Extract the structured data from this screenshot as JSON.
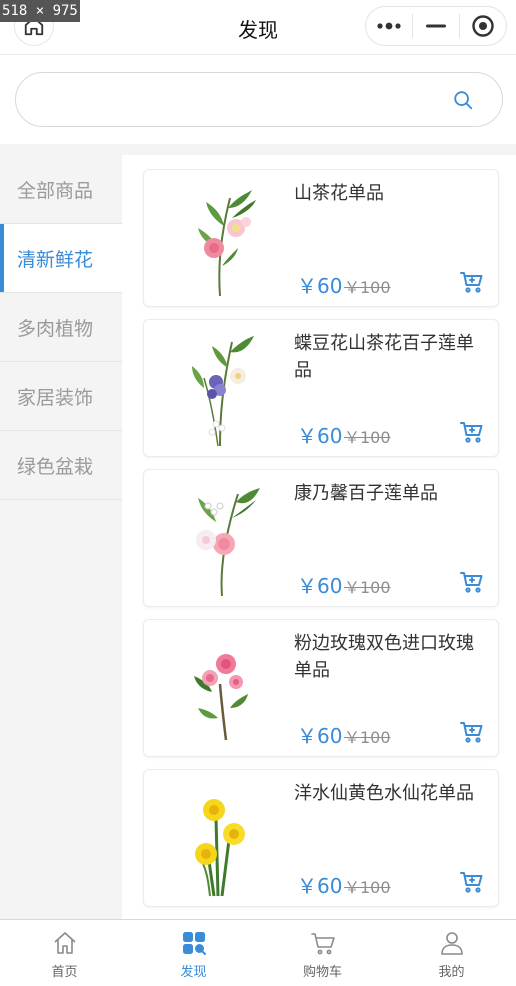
{
  "screen_size_label": "518 × 975",
  "navbar": {
    "title": "发现"
  },
  "search": {
    "value": "",
    "placeholder": ""
  },
  "sidebar": {
    "items": [
      {
        "label": "全部商品",
        "active": false
      },
      {
        "label": "清新鲜花",
        "active": true
      },
      {
        "label": "多肉植物",
        "active": false
      },
      {
        "label": "家居装饰",
        "active": false
      },
      {
        "label": "绿色盆栽",
        "active": false
      }
    ]
  },
  "products": [
    {
      "name": "山茶花单品",
      "price": "￥60",
      "old_price": "￥100",
      "image": "pink-camellia-flower"
    },
    {
      "name": "蝶豆花山茶花百子莲单品",
      "price": "￥60",
      "old_price": "￥100",
      "image": "butterfly-pea-camellia-agapanthus-bouquet"
    },
    {
      "name": "康乃馨百子莲单品",
      "price": "￥60",
      "old_price": "￥100",
      "image": "carnation-agapanthus-bouquet"
    },
    {
      "name": "粉边玫瑰双色进口玫瑰单品",
      "price": "￥60",
      "old_price": "￥100",
      "image": "pink-spray-roses"
    },
    {
      "name": "洋水仙黄色水仙花单品",
      "price": "￥60",
      "old_price": "￥100",
      "image": "yellow-daffodils"
    }
  ],
  "tabbar": {
    "items": [
      {
        "label": "首页",
        "icon": "home-icon",
        "active": false
      },
      {
        "label": "发现",
        "icon": "discover-grid-icon",
        "active": true
      },
      {
        "label": "购物车",
        "icon": "shopping-cart-icon",
        "active": false
      },
      {
        "label": "我的",
        "icon": "user-icon",
        "active": false
      }
    ]
  },
  "colors": {
    "accent": "#3a8bd8",
    "sidebar_bg": "#f4f4f4",
    "strike_price": "#8e8e8e"
  }
}
